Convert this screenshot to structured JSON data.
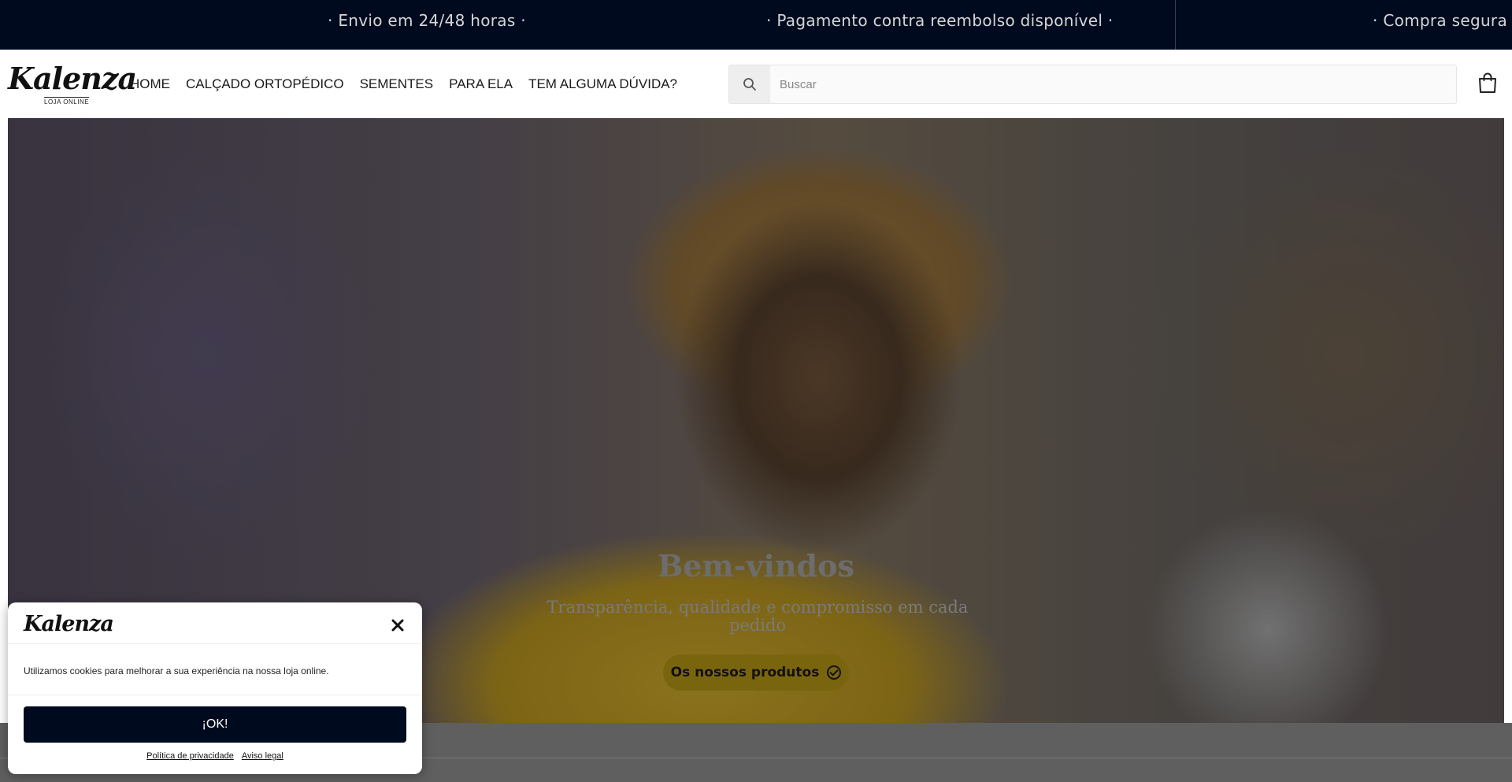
{
  "announcement": {
    "messages": [
      "· Envio em 24/48 horas ·",
      "· Pagamento contra reembolso disponível ·",
      "· Compra segura ·"
    ]
  },
  "header": {
    "logo_text": "Kalenza",
    "logo_subtitle": "LOJA ONLINE",
    "nav": [
      "HOME",
      "CALÇADO ORTOPÉDICO",
      "SEMENTES",
      "PARA ELA",
      "TEM ALGUMA DÚVIDA?"
    ],
    "search_placeholder": "Buscar",
    "icons": {
      "search": "search-icon",
      "cart": "shopping-bag-icon"
    }
  },
  "hero": {
    "title": "Bem-vindos",
    "subtitle": "Transparência, qualidade e compromisso em cada pedido",
    "cta_label": "Os nossos produtos",
    "cta_color": "#f2c81d"
  },
  "cookie": {
    "logo_text": "Kalenza",
    "message": "Utilizamos cookies para melhorar a sua experiência na nossa loja online.",
    "ok_label": "¡OK!",
    "links": [
      "Política de privacidade",
      "Aviso legal"
    ],
    "button_color": "#000a1f"
  }
}
